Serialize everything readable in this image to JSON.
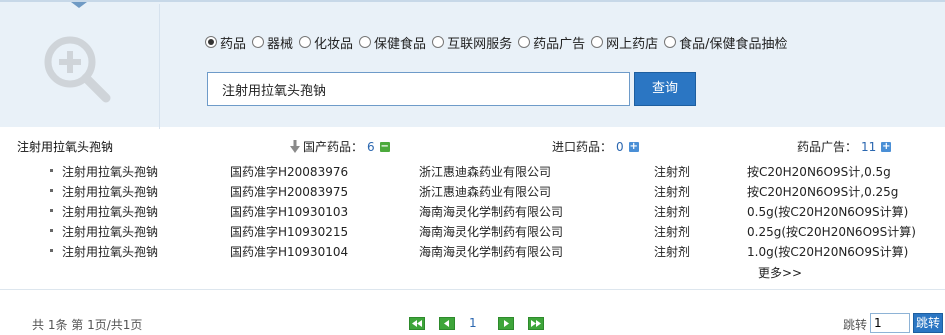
{
  "search": {
    "categories": [
      {
        "label": "药品",
        "checked": true
      },
      {
        "label": "器械",
        "checked": false
      },
      {
        "label": "化妆品",
        "checked": false
      },
      {
        "label": "保健食品",
        "checked": false
      },
      {
        "label": "互联网服务",
        "checked": false
      },
      {
        "label": "药品广告",
        "checked": false
      },
      {
        "label": "网上药店",
        "checked": false
      },
      {
        "label": "食品/保健食品抽检",
        "checked": false
      }
    ],
    "query_value": "注射用拉氧头孢钠",
    "button_label": "查询"
  },
  "results": {
    "title": "注射用拉氧头孢钠",
    "domestic_label": "国产药品：",
    "domestic_count": "6",
    "imported_label": "进口药品：",
    "imported_count": "0",
    "ads_label": "药品广告：",
    "ads_count": "11",
    "rows": [
      {
        "name": "注射用拉氧头孢钠",
        "approval": "国药准字H20083976",
        "company": "浙江惠迪森药业有限公司",
        "form": "注射剂",
        "spec": "按C20H20N6O9S计,0.5g"
      },
      {
        "name": "注射用拉氧头孢钠",
        "approval": "国药准字H20083975",
        "company": "浙江惠迪森药业有限公司",
        "form": "注射剂",
        "spec": "按C20H20N6O9S计,0.25g"
      },
      {
        "name": "注射用拉氧头孢钠",
        "approval": "国药准字H10930103",
        "company": "海南海灵化学制药有限公司",
        "form": "注射剂",
        "spec": "0.5g(按C20H20N6O9S计算)"
      },
      {
        "name": "注射用拉氧头孢钠",
        "approval": "国药准字H10930215",
        "company": "海南海灵化学制药有限公司",
        "form": "注射剂",
        "spec": "0.25g(按C20H20N6O9S计算)"
      },
      {
        "name": "注射用拉氧头孢钠",
        "approval": "国药准字H10930104",
        "company": "海南海灵化学制药有限公司",
        "form": "注射剂",
        "spec": "1.0g(按C20H20N6O9S计算)"
      }
    ],
    "more_label": "更多>>"
  },
  "pagination": {
    "info": "共 1条   第 1页/共1页",
    "current_page": "1",
    "jump_label": "跳转",
    "jump_value": "1",
    "jump_button": "跳转"
  },
  "colors": {
    "panel_bg": "#e9f1f8",
    "accent_blue": "#2b76c3",
    "pager_green": "#3ea53a",
    "count_blue": "#2b67b0"
  },
  "icons": {
    "search_panel": "magnifier-plus-icon",
    "sort": "sort-down-arrow-icon",
    "domestic_toggle": "collapse-minus-icon",
    "imported_toggle": "expand-plus-icon",
    "ads_toggle": "expand-plus-icon"
  }
}
